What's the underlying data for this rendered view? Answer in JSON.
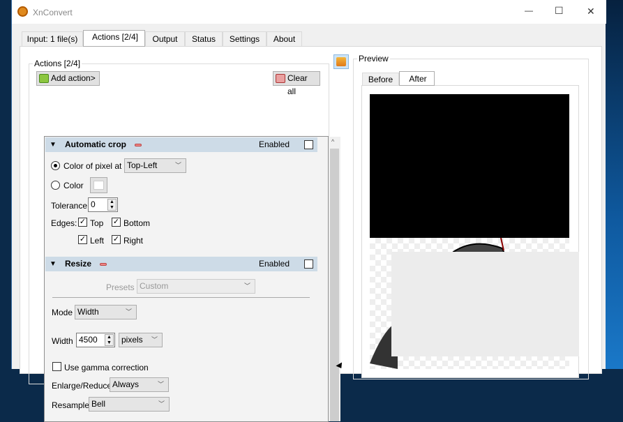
{
  "window": {
    "title": "XnConvert",
    "minimize": "—",
    "maximize": "☐",
    "close": "✕"
  },
  "tabs": [
    {
      "label": "Input: 1 file(s)"
    },
    {
      "label": "Actions [2/4]",
      "selected": true
    },
    {
      "label": "Output"
    },
    {
      "label": "Status"
    },
    {
      "label": "Settings"
    },
    {
      "label": "About"
    }
  ],
  "actions": {
    "group_label": "Actions [2/4]",
    "add_action": "Add action>",
    "clear_all": "Clear all",
    "auto_crop": {
      "title": "Automatic crop",
      "enabled_label": "Enabled",
      "enabled": false,
      "color_pixel_label": "Color of pixel at",
      "color_pixel_value": "Top-Left",
      "color_label": "Color",
      "tolerance_label": "Tolerance",
      "tolerance_value": "0",
      "edges_label": "Edges:",
      "edges": {
        "top": "Top",
        "bottom": "Bottom",
        "left": "Left",
        "right": "Right"
      },
      "check": "✓"
    },
    "resize": {
      "title": "Resize",
      "enabled_label": "Enabled",
      "enabled": false,
      "presets_label": "Presets",
      "presets_value": "Custom",
      "mode_label": "Mode",
      "mode_value": "Width",
      "width_label": "Width",
      "width_value": "4500",
      "unit_value": "pixels",
      "gamma_label": "Use gamma correction",
      "enlarge_label": "Enlarge/Reduce",
      "enlarge_value": "Always",
      "resample_label": "Resample",
      "resample_value": "Bell"
    }
  },
  "preview": {
    "group_label": "Preview",
    "tabs": [
      {
        "label": "Before"
      },
      {
        "label": "After",
        "selected": true
      }
    ]
  }
}
